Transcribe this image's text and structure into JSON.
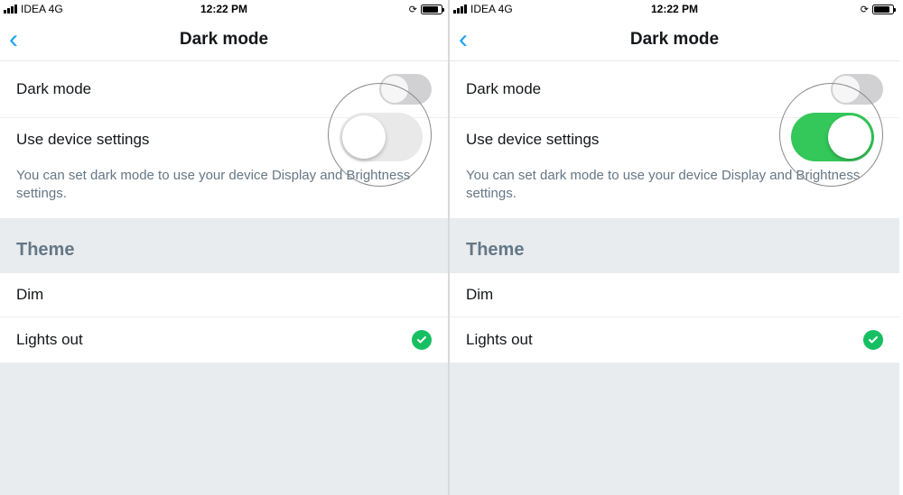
{
  "status": {
    "carrier": "IDEA 4G",
    "time": "12:22 PM"
  },
  "nav": {
    "title": "Dark mode"
  },
  "rows": {
    "dark_mode": "Dark mode",
    "use_device": "Use device settings",
    "desc": "You can set dark mode to use your device Display and Brightness settings."
  },
  "theme": {
    "header": "Theme",
    "dim": "Dim",
    "lights_out": "Lights out"
  },
  "panes": {
    "left": {
      "use_device_on": false
    },
    "right": {
      "use_device_on": true
    }
  }
}
